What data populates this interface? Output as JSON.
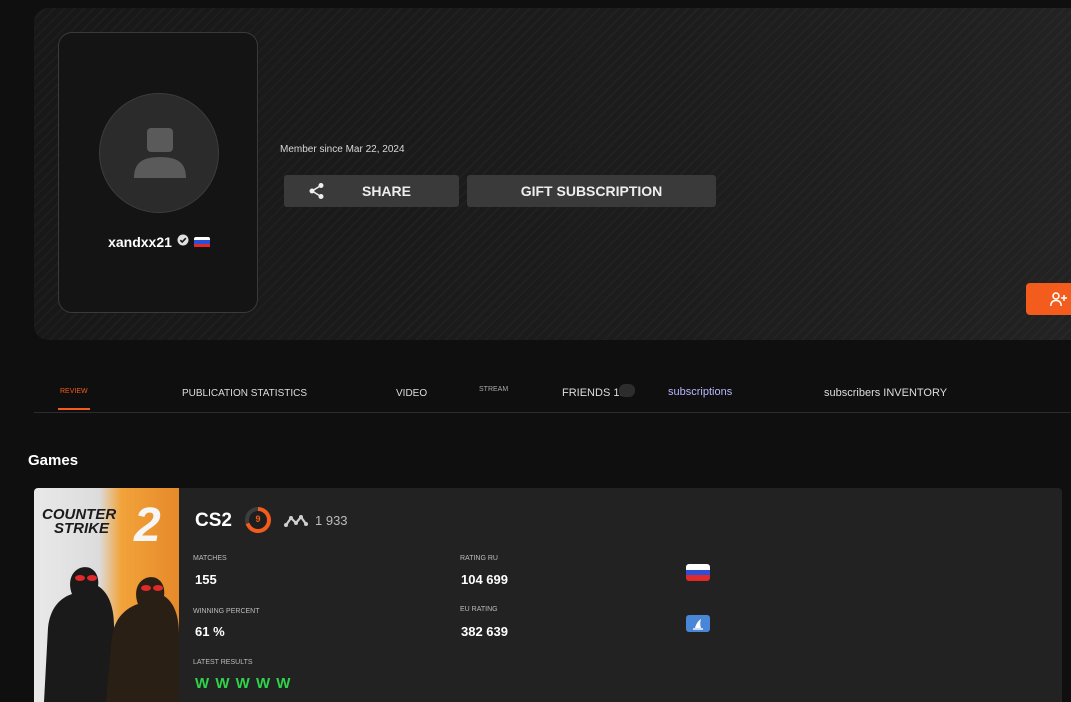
{
  "profile": {
    "username": "xandxx21",
    "member_since": "Member since Mar 22, 2024",
    "verified_icon": "verified-check-icon",
    "flag": "russia-flag"
  },
  "actions": {
    "share_label": "SHARE",
    "gift_label": "GIFT SUBSCRIPTION"
  },
  "tabs": {
    "review": "REVIEW",
    "publication_statistics": "PUBLICATION STATISTICS",
    "video": "VIDEO",
    "stream": "STREAM",
    "friends": "FRIENDS 18",
    "subscriptions": "subscriptions",
    "subscribers_inventory": "subscribers INVENTORY"
  },
  "games_section": {
    "heading": "Games",
    "game": {
      "cover_title_line1": "COUNTER",
      "cover_title_line2": "STRIKE",
      "cover_title_2": "2",
      "name": "CS2",
      "level": "9",
      "elo": "1 933",
      "stats": {
        "matches_label": "MATCHES",
        "matches_value": "155",
        "winning_percent_label": "WINNING PERCENT",
        "winning_percent_value": "61 %",
        "latest_results_label": "LATEST RESULTS",
        "latest_results_value": "W W W W W",
        "rating_ru_label": "RATING RU",
        "rating_ru_value": "104 699",
        "eu_rating_label": "EU RATING",
        "eu_rating_value": "382 639"
      }
    }
  },
  "colors": {
    "accent": "#f35c1c",
    "win": "#2fd24a",
    "subscriptions_link": "#b9b6ff"
  }
}
